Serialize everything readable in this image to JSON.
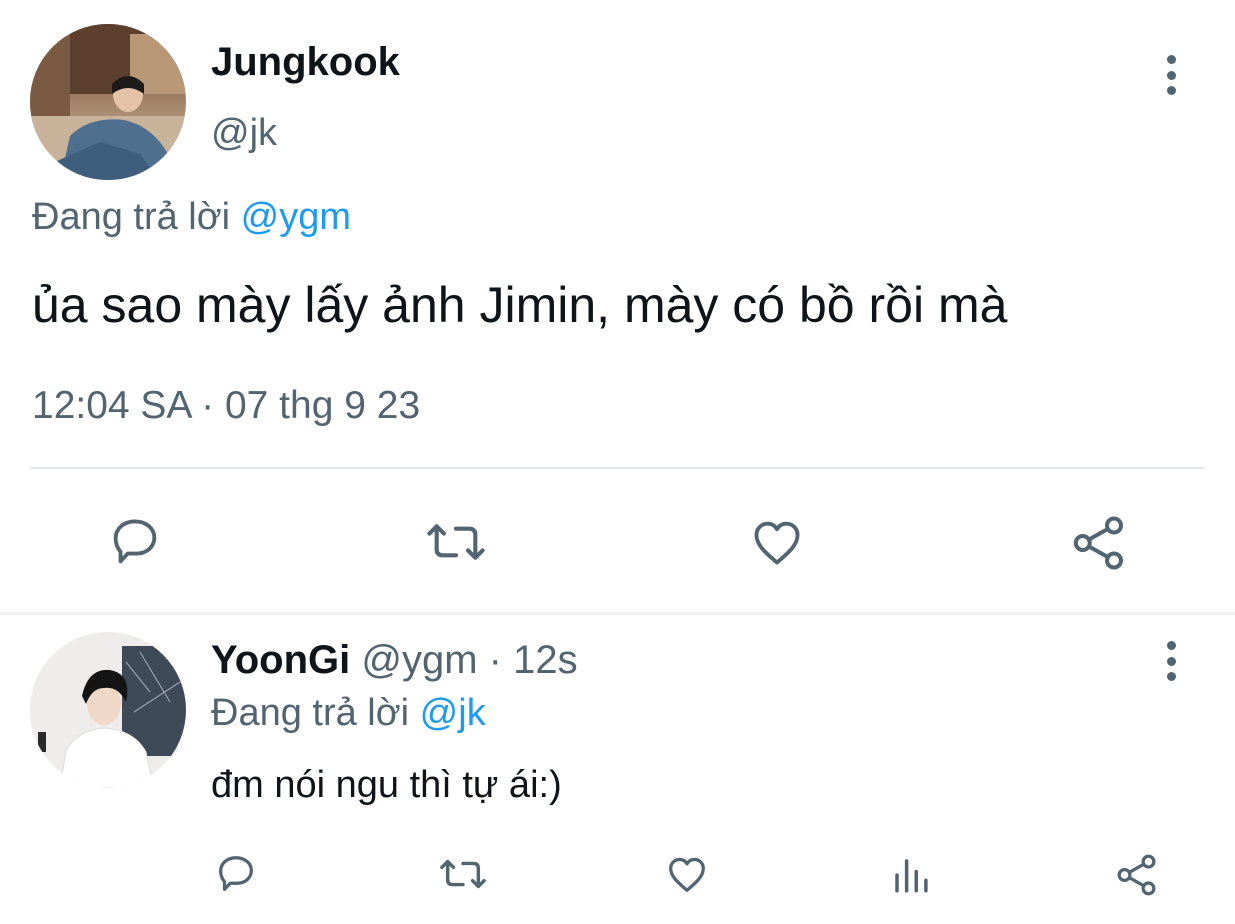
{
  "main_tweet": {
    "display_name": "Jungkook",
    "handle": "@jk",
    "replying_prefix": "Đang trả lời",
    "replying_to": "@ygm",
    "text": "ủa sao mày lấy ảnh Jimin, mày có bồ rồi mà",
    "timestamp": "12:04 SA · 07 thg 9 23"
  },
  "reply_tweet": {
    "display_name": "YoonGi",
    "handle_time": "@ygm · 12s",
    "replying_prefix": "Đang trả lời",
    "replying_to": "@jk",
    "text": "đm nói ngu thì tự ái:)"
  },
  "icons": {
    "reply": "speech-bubble-icon",
    "retweet": "retweet-arrows-icon",
    "like": "heart-icon",
    "views": "bar-chart-icon",
    "share": "share-nodes-icon",
    "more": "vertical-ellipsis-icon"
  },
  "colors": {
    "text_primary": "#0f1419",
    "text_secondary": "#536471",
    "link": "#1d9bf0",
    "divider": "#e6e9eb"
  }
}
